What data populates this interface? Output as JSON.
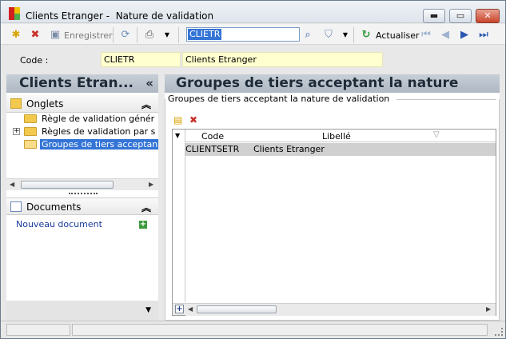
{
  "window": {
    "title": "Clients Etranger -  Nature de validation",
    "controls": {
      "minimize": "▬",
      "maximize": "▭",
      "close": "✕"
    }
  },
  "toolbar": {
    "save_label": "Enregistrer",
    "search_value": "CLIETR",
    "refresh_label": "Actualiser"
  },
  "form": {
    "code_label": "Code :",
    "code_value": "CLIETR",
    "libelle_value": "Clients Etranger"
  },
  "left_panel": {
    "title": "Clients Etran...",
    "collapse_glyph": "«",
    "onglets": {
      "label": "Onglets",
      "items": [
        {
          "label": "Règle de validation génér",
          "selected": false,
          "expandable": false
        },
        {
          "label": "Règles de validation par s",
          "selected": false,
          "expandable": true
        },
        {
          "label": "Groupes de tiers acceptan",
          "selected": true,
          "expandable": false
        }
      ]
    },
    "documents": {
      "label": "Documents",
      "new_document": "Nouveau document"
    }
  },
  "right_panel": {
    "title": "Groupes de tiers acceptant la nature",
    "group_caption": "Groupes de tiers acceptant la nature de validation",
    "grid": {
      "columns": [
        "Code",
        "Libellé"
      ],
      "rows": [
        {
          "code": "CLIENTSETR",
          "libelle": "Clients Etranger"
        }
      ]
    }
  },
  "colors": {
    "header_gradient_top": "#c7ced6",
    "header_gradient_bottom": "#aeb8c3",
    "selection": "#3374d6",
    "field_highlight": "#ffffcf",
    "row_selected": "#d0d0d0",
    "link": "#1a3c9c"
  },
  "icons": {
    "app": "app-logo-icon",
    "new": "new-record-icon",
    "delete": "delete-icon",
    "save": "save-icon",
    "refresh_cycle": "refresh-cycle-icon",
    "print": "print-icon",
    "search": "magnifier-icon",
    "filter": "funnel-icon",
    "refresh": "refresh-icon",
    "first": "first-icon",
    "prev": "previous-icon",
    "next": "next-icon",
    "last": "last-icon"
  }
}
